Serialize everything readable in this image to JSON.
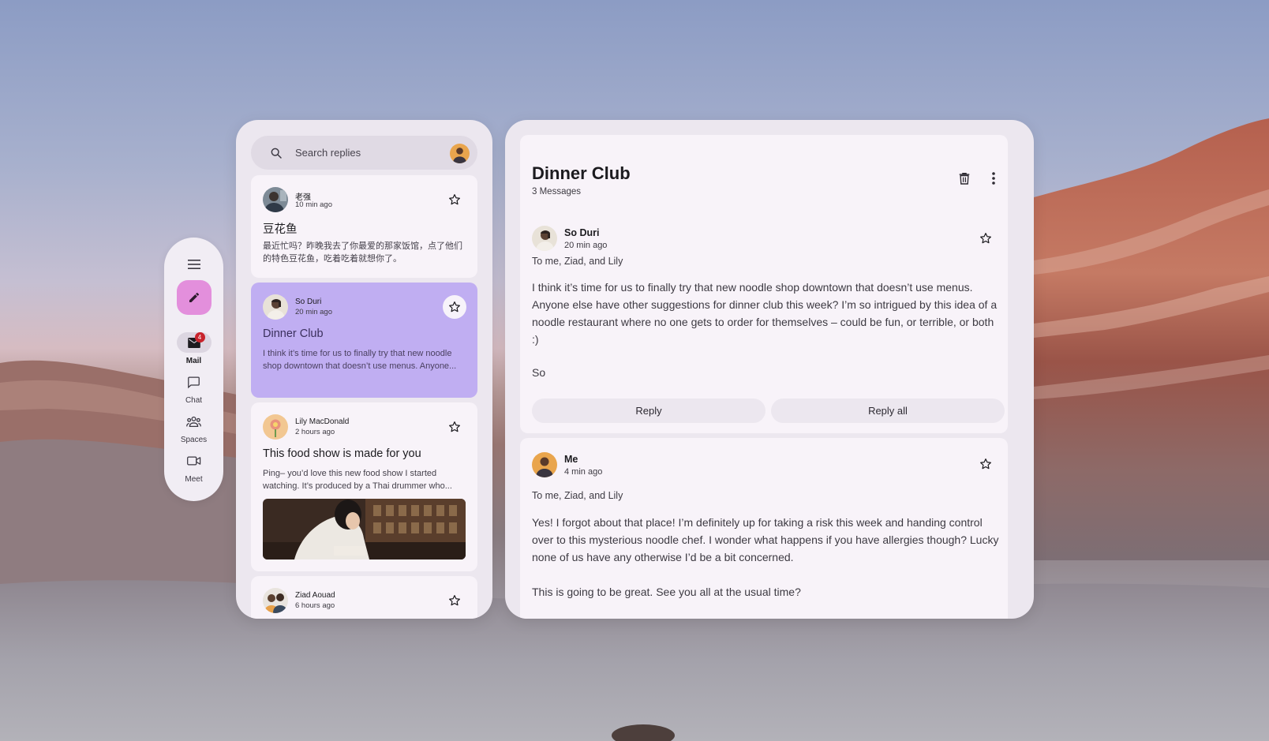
{
  "rail": {
    "items": [
      {
        "label": "Mail",
        "badge": "4",
        "icon": "mail-icon"
      },
      {
        "label": "Chat",
        "icon": "chat-icon"
      },
      {
        "label": "Spaces",
        "icon": "spaces-icon"
      },
      {
        "label": "Meet",
        "icon": "meet-icon"
      }
    ]
  },
  "search": {
    "placeholder": "Search replies"
  },
  "list": {
    "items": [
      {
        "sender": "老强",
        "time": "10 min ago",
        "subject": "豆花鱼",
        "preview": "最近忙吗？昨晚我去了你最爱的那家饭馆，点了他们的特色豆花鱼，吃着吃着就想你了。"
      },
      {
        "sender": "So Duri",
        "time": "20 min ago",
        "subject": "Dinner Club",
        "preview": "I think it’s time for us to finally try that new noodle shop downtown that doesn’t use menus. Anyone..."
      },
      {
        "sender": "Lily MacDonald",
        "time": "2 hours ago",
        "subject": "This food show is made for you",
        "preview": "Ping– you’d love this new food show I started watching. It’s produced by a Thai drummer who..."
      },
      {
        "sender": "Ziad Aouad",
        "time": "6 hours ago"
      }
    ]
  },
  "thread": {
    "title": "Dinner Club",
    "count": "3 Messages",
    "messages": [
      {
        "sender": "So Duri",
        "time": "20 min ago",
        "to": "To me, Ziad, and Lily",
        "body": "I think it’s time for us to finally try that new noodle shop downtown that doesn’t use menus. Anyone else have other suggestions for dinner club this week? I’m so intrigued by this idea of a noodle restaurant where no one gets to order for themselves – could be fun, or terrible, or both :)",
        "signature": "So",
        "reply": "Reply",
        "reply_all": "Reply all"
      },
      {
        "sender": "Me",
        "time": "4 min ago",
        "to": "To me, Ziad, and Lily",
        "body": "Yes! I forgot about that place! I’m definitely up for taking a risk this week and handing control over to this mysterious noodle chef. I wonder what happens if you have allergies though? Lucky none of us have any otherwise I’d be a bit concerned.",
        "body2": "This is going to be great. See you all at the usual time?"
      }
    ]
  },
  "colors": {
    "accent": "#c0aef2",
    "compose": "#e38fdc",
    "panel": "#ece7ef",
    "card": "#f8f3f9",
    "badge": "#c8232c"
  }
}
